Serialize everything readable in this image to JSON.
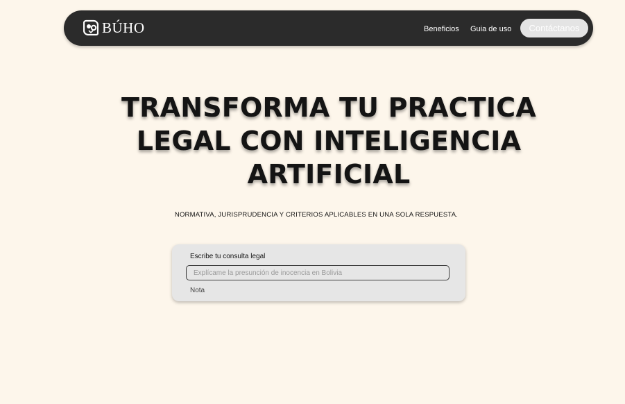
{
  "nav": {
    "logo_text": "BÚHO",
    "logo_icon": "owl-face-icon",
    "links": [
      {
        "label": "Beneficios"
      },
      {
        "label": "Guia de uso"
      }
    ],
    "cta_label": "Contáctanos"
  },
  "hero": {
    "title_lines": [
      "TRANSFORMA TU PRACTICA",
      "LEGAL CON INTELIGENCIA",
      "ARTIFICIAL"
    ],
    "subtitle": "NORMATIVA, JURISPRUDENCIA Y CRITERIOS APLICABLES EN UNA SOLA RESPUESTA."
  },
  "query": {
    "label": "Escribe tu consulta legal",
    "placeholder": "Explícame la presunción de inocencia en Bolivia",
    "value": "",
    "note": "Nota"
  },
  "colors": {
    "background": "#fdf6eb",
    "nav_background": "#2b2b2b",
    "cta_background": "#e4e4e4",
    "card_background": "#e6e6e6"
  }
}
